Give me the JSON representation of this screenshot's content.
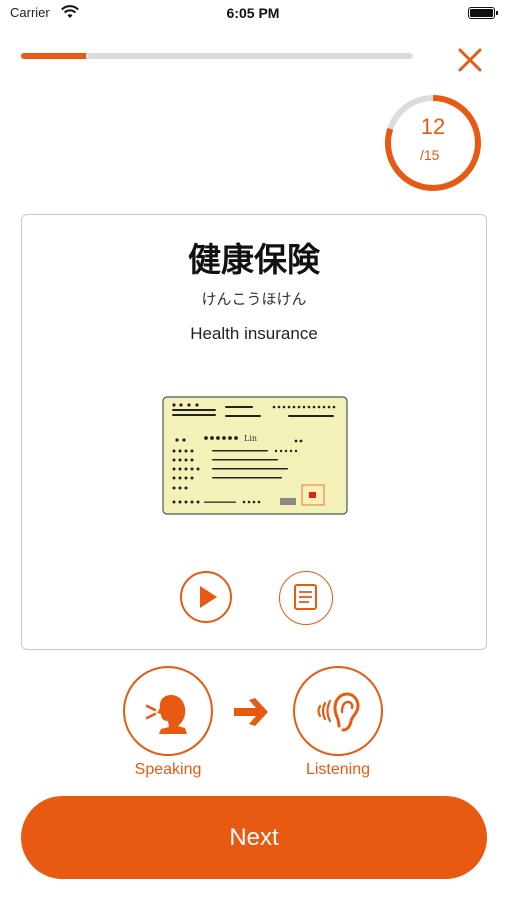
{
  "status_bar": {
    "carrier": "Carrier",
    "time": "6:05 PM"
  },
  "progress": {
    "fraction": 0.167,
    "color": "#e85a12"
  },
  "counter": {
    "current": "12",
    "total": "/15",
    "ring_fraction": 0.8
  },
  "card": {
    "word": "健康保険",
    "reading": "けんこうほけん",
    "meaning": "Health insurance",
    "image": {
      "card_id_name": "Lin"
    }
  },
  "modes": {
    "speaking_label": "Speaking",
    "listening_label": "Listening"
  },
  "next_button": {
    "label": "Next"
  },
  "colors": {
    "accent": "#e85a12",
    "card_image_bg": "#f2f2b8"
  },
  "icons": {
    "close": "close-icon",
    "play": "play-icon",
    "notes": "notes-icon",
    "speaking": "speaking-person-icon",
    "listening": "ear-icon",
    "arrow": "arrow-right-icon"
  }
}
